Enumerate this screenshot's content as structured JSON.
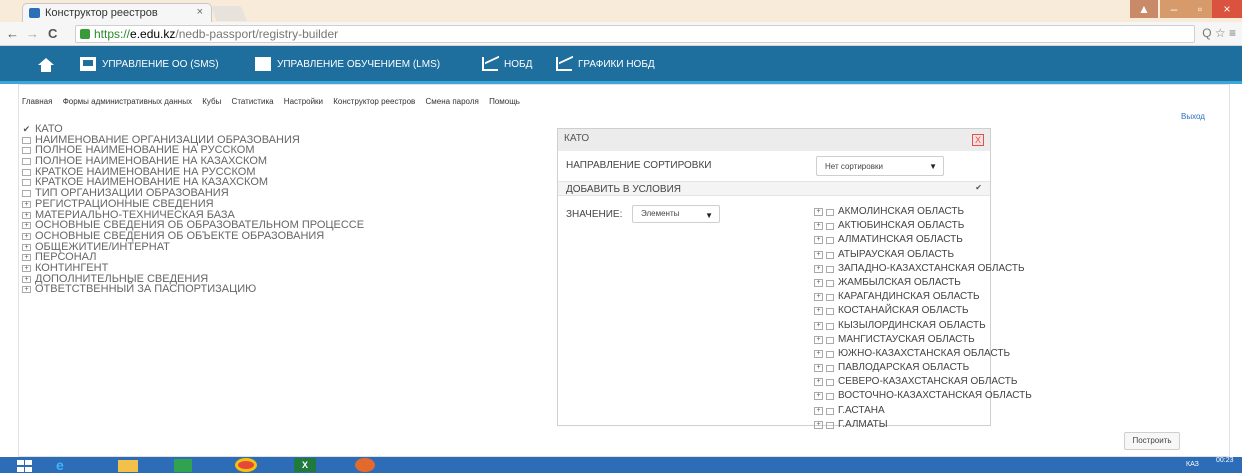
{
  "browser": {
    "tab_title": "Конструктор реестров",
    "tab_close": "×",
    "url_scheme": "https://",
    "url_host": "e.edu.kz",
    "url_path": "/nedb-passport/registry-builder",
    "back_icon": "←",
    "forward_icon": "→",
    "reload_icon": "C",
    "omni_icons": "Q ☆ ≡",
    "window_buttons": {
      "user": "▲",
      "minimize": "–",
      "maximize": "▫",
      "close": "×"
    }
  },
  "app_nav": {
    "items": [
      {
        "label": "УПРАВЛЕНИЕ ОО (SMS)",
        "icon": "monitor-icon"
      },
      {
        "label": "УПРАВЛЕНИЕ ОБУЧЕНИЕМ (LMS)",
        "icon": "box-icon"
      },
      {
        "label": "НОБД",
        "icon": "chart-icon"
      },
      {
        "label": "ГРАФИКИ НОБД",
        "icon": "chart-icon"
      }
    ]
  },
  "menu": {
    "items": [
      "Главная",
      "Формы административных данных",
      "Кубы",
      "Статистика",
      "Настройки",
      "Конструктор реестров",
      "Смена пароля",
      "Помощь"
    ],
    "logout": "Выход"
  },
  "tree": {
    "items": [
      {
        "label": "КАТО",
        "mark": "check"
      },
      {
        "label": "НАИМЕНОВАНИЕ ОРГАНИЗАЦИИ ОБРАЗОВАНИЯ",
        "mark": "box"
      },
      {
        "label": "ПОЛНОЕ НАИМЕНОВАНИЕ НА РУССКОМ",
        "mark": "box"
      },
      {
        "label": "ПОЛНОЕ НАИМЕНОВАНИЕ НА КАЗАХСКОМ",
        "mark": "box"
      },
      {
        "label": "КРАТКОЕ НАИМЕНОВАНИЕ НА РУССКОМ",
        "mark": "box"
      },
      {
        "label": "КРАТКОЕ НАИМЕНОВАНИЕ НА КАЗАХСКОМ",
        "mark": "box"
      },
      {
        "label": "ТИП ОРГАНИЗАЦИИ ОБРАЗОВАНИЯ",
        "mark": "box"
      },
      {
        "label": "РЕГИСТРАЦИОННЫЕ СВЕДЕНИЯ",
        "mark": "plus"
      },
      {
        "label": "МАТЕРИАЛЬНО-ТЕХНИЧЕСКАЯ БАЗА",
        "mark": "plus"
      },
      {
        "label": "ОСНОВНЫЕ СВЕДЕНИЯ ОБ ОБРАЗОВАТЕЛЬНОМ ПРОЦЕССЕ",
        "mark": "plus"
      },
      {
        "label": "ОСНОВНЫЕ СВЕДЕНИЯ ОБ ОБЪЕКТЕ ОБРАЗОВАНИЯ",
        "mark": "plus"
      },
      {
        "label": "ОБЩЕЖИТИЕ/ИНТЕРНАТ",
        "mark": "plus"
      },
      {
        "label": "ПЕРСОНАЛ",
        "mark": "plus"
      },
      {
        "label": "КОНТИНГЕНТ",
        "mark": "plus"
      },
      {
        "label": "ДОПОЛНИТЕЛЬНЫЕ СВЕДЕНИЯ",
        "mark": "plus"
      },
      {
        "label": "ОТВЕТСТВЕННЫЙ ЗА ПАСПОРТИЗАЦИЮ",
        "mark": "plus"
      }
    ]
  },
  "panel": {
    "title": "КАТО",
    "close": "X",
    "sort_label": "НАПРАВЛЕНИЕ СОРТИРОВКИ",
    "sort_value": "Нет сортировки",
    "add_label": "ДОБАВИТЬ В УСЛОВИЯ",
    "add_check": "✔",
    "value_label": "ЗНАЧЕНИЕ:",
    "value_select": "Элементы",
    "caret": "▼",
    "regions": [
      "АКМОЛИНСКАЯ ОБЛАСТЬ",
      "АКТЮБИНСКАЯ ОБЛАСТЬ",
      "АЛМАТИНСКАЯ ОБЛАСТЬ",
      "АТЫРАУСКАЯ ОБЛАСТЬ",
      "ЗАПАДНО-КАЗАХСТАНСКАЯ ОБЛАСТЬ",
      "ЖАМБЫЛСКАЯ ОБЛАСТЬ",
      "КАРАГАНДИНСКАЯ ОБЛАСТЬ",
      "КОСТАНАЙСКАЯ ОБЛАСТЬ",
      "КЫЗЫЛОРДИНСКАЯ ОБЛАСТЬ",
      "МАНГИСТАУСКАЯ ОБЛАСТЬ",
      "ЮЖНО-КАЗАХСТАНСКАЯ ОБЛАСТЬ",
      "ПАВЛОДАРСКАЯ ОБЛАСТЬ",
      "СЕВЕРО-КАЗАХСТАНСКАЯ ОБЛАСТЬ",
      "ВОСТОЧНО-КАЗАХСТАНСКАЯ ОБЛАСТЬ",
      "Г.АСТАНА",
      "Г.АЛМАТЫ"
    ]
  },
  "build_button": "Построить",
  "taskbar": {
    "lang": "КАЗ",
    "time": "00:23"
  },
  "colors": {
    "nav_bg": "#1e6e9e",
    "nav_accent": "#3aa8d8",
    "taskbar": "#2d6db7",
    "link": "#2a6fb8"
  }
}
